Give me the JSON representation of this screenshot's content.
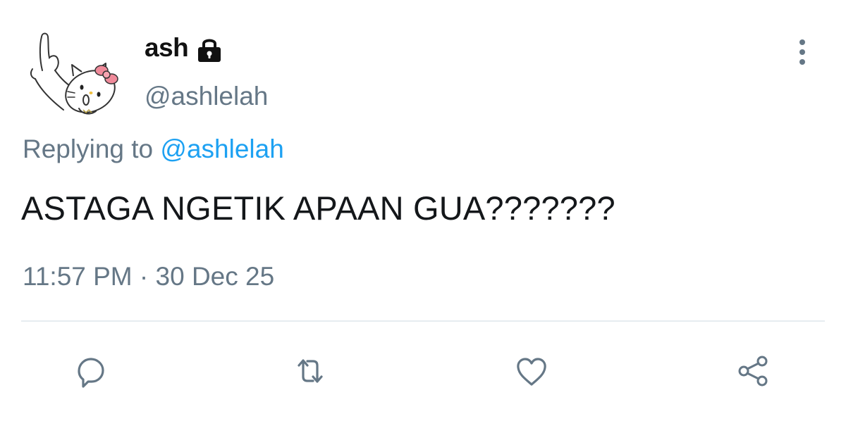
{
  "tweet": {
    "display_name": "ash",
    "handle": "@ashlelah",
    "replying_prefix": "Replying to ",
    "replying_to": "@ashlelah",
    "text": "ASTAGA NGETIK APAAN GUA???????",
    "timestamp": "11:57 PM · 30 Dec 25"
  },
  "icons": {
    "avatar": "hello-kitty-avatar",
    "protected": "lock-icon",
    "more": "more-vertical-icon",
    "reply": "reply-bubble-icon",
    "retweet": "retweet-icon",
    "like": "heart-icon",
    "share": "share-icon"
  },
  "colors": {
    "text_primary": "#14171a",
    "text_secondary": "#657786",
    "mention": "#1da1f2",
    "divider": "#e6ecf0"
  }
}
